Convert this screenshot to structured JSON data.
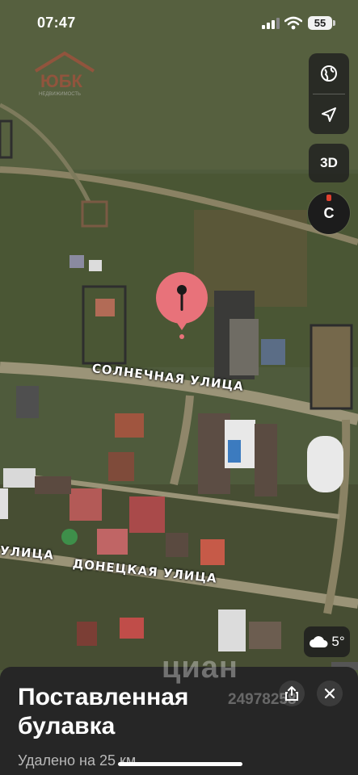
{
  "status_bar": {
    "time": "07:47",
    "battery": "55"
  },
  "map_controls": {
    "globe_icon": "globe-icon",
    "location_icon": "location-arrow-icon",
    "view_3d_label": "3D",
    "compass_label": "C"
  },
  "streets": {
    "solnechnaya": "СОЛНЕЧНАЯ УЛИЦА",
    "donetskaya": "ДОНЕЦКАЯ УЛИЦА",
    "left_fragment": "УЛИЦА"
  },
  "weather": {
    "temperature": "5°",
    "icon": "cloud-icon"
  },
  "watermarks": {
    "logo_text": "ЮБК",
    "logo_sub": "НЕДВИЖИМОСТЬ",
    "cian_text": "циан",
    "cian_number": "24978258"
  },
  "sheet": {
    "title": "Поставленная булавка",
    "distance": "Удалено на 25 км"
  },
  "colors": {
    "pin": "#e8727a",
    "sheet_bg": "#262626"
  }
}
